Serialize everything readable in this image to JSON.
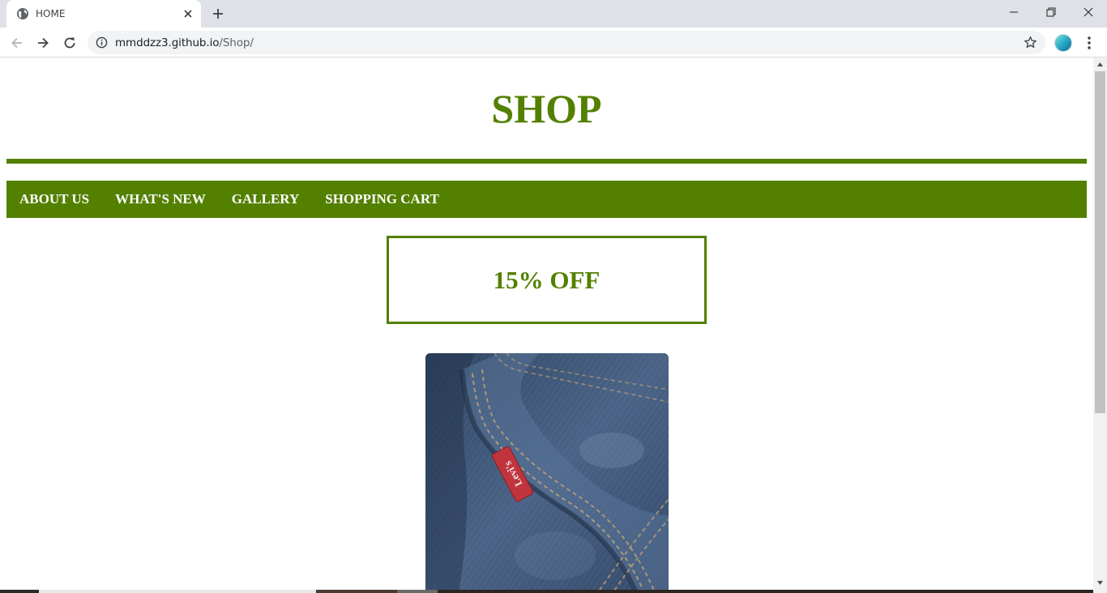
{
  "browser": {
    "tab": {
      "title": "HOME"
    },
    "url": {
      "host": "mmddzz3.github.io",
      "path": "/Shop/"
    },
    "icons": {
      "favicon": "globe-icon",
      "close": "close-icon",
      "new_tab": "plus-icon",
      "back": "arrow-left-icon",
      "forward": "arrow-right-icon",
      "reload": "reload-icon",
      "info": "info-icon",
      "bookmark": "star-icon",
      "menu": "more-vertical-icon"
    }
  },
  "page": {
    "title": "SHOP",
    "nav": [
      {
        "label": "ABOUT US"
      },
      {
        "label": "WHAT'S NEW"
      },
      {
        "label": "GALLERY"
      },
      {
        "label": "SHOPPING CART"
      }
    ],
    "promo": "15% OFF",
    "product_image": {
      "subject": "denim-jeans-pocket-photo",
      "tag_text": "Levi's"
    }
  },
  "colors": {
    "brand_green": "#548000",
    "tab_strip": "#dee1e6",
    "omnibox": "#f1f3f4",
    "denim": "#3d5677",
    "tag_red": "#c0343e"
  }
}
